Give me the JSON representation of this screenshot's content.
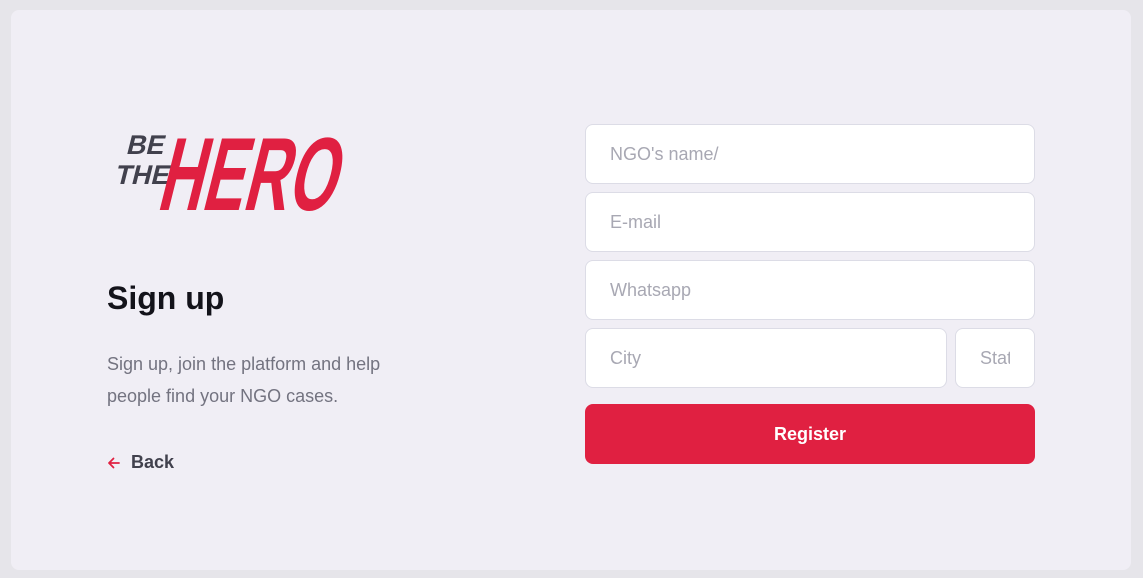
{
  "brand": {
    "line1": "BE",
    "line2": "THE",
    "word": "HERO",
    "accent_color": "#e02041",
    "dark_color": "#41414d"
  },
  "page": {
    "title": "Sign up",
    "description": "Sign up, join the platform and help people find your NGO cases.",
    "back_label": "Back",
    "back_icon": "arrow-left-icon"
  },
  "form": {
    "name_placeholder": "NGO's name/",
    "email_placeholder": "E-mail",
    "whatsapp_placeholder": "Whatsapp",
    "city_placeholder": "City",
    "state_placeholder": "State",
    "register_label": "Register"
  }
}
